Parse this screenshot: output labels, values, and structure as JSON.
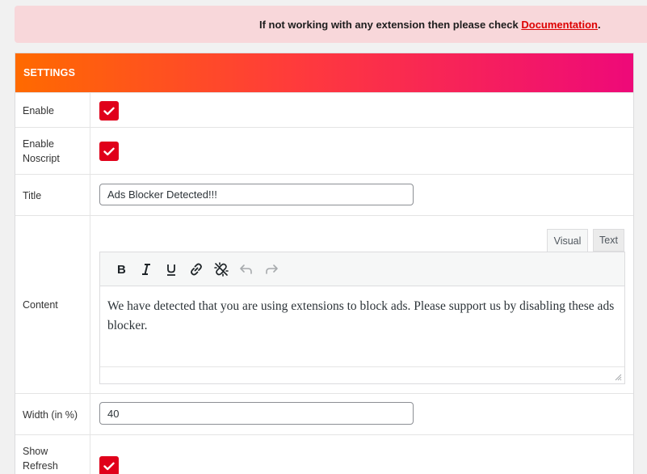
{
  "notice": {
    "prefix": "If not working with any extension then please check ",
    "link": "Documentation",
    "suffix": "."
  },
  "panel": {
    "title": "SETTINGS"
  },
  "fields": {
    "enable": {
      "label": "Enable",
      "checked": true
    },
    "noscript": {
      "label": "Enable Noscript",
      "checked": true
    },
    "title": {
      "label": "Title",
      "value": "Ads Blocker Detected!!!"
    },
    "content": {
      "label": "Content",
      "tabs": [
        "Visual",
        "Text"
      ],
      "active_tab": "Visual",
      "toolbar": [
        "bold-icon",
        "italic-icon",
        "underline-icon",
        "link-icon",
        "unlink-icon",
        "undo-icon",
        "redo-icon"
      ],
      "body": "We have detected that you are using extensions to block ads. Please support us by disabling these ads blocker."
    },
    "width": {
      "label": "Width (in %)",
      "value": "40"
    },
    "refresh": {
      "label": "Show Refresh",
      "checked": true
    }
  },
  "colors": {
    "accent": "#e0001a",
    "gradient_start": "#ff6a00",
    "gradient_end": "#ee0979",
    "notice_bg": "#f8d7da",
    "link": "#dd0000"
  }
}
